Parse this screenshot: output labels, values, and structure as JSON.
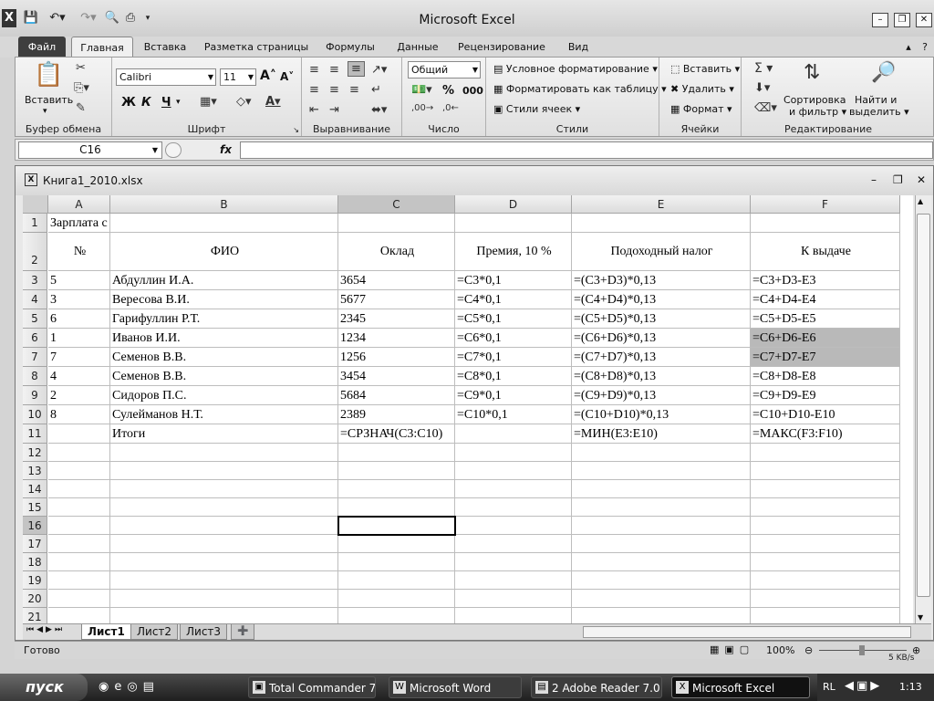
{
  "app": {
    "title": "Microsoft Excel",
    "tabs": [
      "Файл",
      "Главная",
      "Вставка",
      "Разметка страницы",
      "Формулы",
      "Данные",
      "Рецензирование",
      "Вид"
    ]
  },
  "ribbon": {
    "clipboard": {
      "paste": "Вставить",
      "label": "Буфер обмена"
    },
    "font": {
      "name": "Calibri",
      "size": "11",
      "label": "Шрифт",
      "bold": "Ж",
      "italic": "К",
      "underline": "Ч"
    },
    "alignment": {
      "label": "Выравнивание"
    },
    "number": {
      "format": "Общий",
      "label": "Число",
      "percent": "%",
      "thousands": "000"
    },
    "styles": {
      "cond": "Условное форматирование",
      "table": "Форматировать как таблицу",
      "cell": "Стили ячеек",
      "label": "Стили"
    },
    "cells": {
      "insert": "Вставить",
      "delete": "Удалить",
      "format": "Формат",
      "label": "Ячейки"
    },
    "editing": {
      "sort1": "Сортировка",
      "sort2": "и фильтр",
      "find1": "Найти и",
      "find2": "выделить",
      "label": "Редактирование"
    }
  },
  "formula_bar": {
    "name_box": "C16",
    "fx": "fx",
    "value": ""
  },
  "workbook": {
    "title": "Книга1_2010.xlsx"
  },
  "sheet": {
    "columns": [
      "A",
      "B",
      "C",
      "D",
      "E",
      "F"
    ],
    "row_numbers": [
      "1",
      "2",
      "3",
      "4",
      "5",
      "6",
      "7",
      "8",
      "9",
      "10",
      "11",
      "12",
      "13",
      "14",
      "15",
      "16",
      "17",
      "18",
      "19",
      "20",
      "21"
    ],
    "title_cell": "Зарплата с",
    "headers": [
      "№",
      "ФИО",
      "Оклад",
      "Премия, 10 %",
      "Подоходный налог",
      "К выдаче"
    ],
    "rows": [
      [
        "5",
        "Абдуллин И.А.",
        "3654",
        "=C3*0,1",
        "=(C3+D3)*0,13",
        "=C3+D3-E3"
      ],
      [
        "3",
        "Вересова В.И.",
        "5677",
        "=C4*0,1",
        "=(C4+D4)*0,13",
        "=C4+D4-E4"
      ],
      [
        "6",
        "Гарифуллин Р.Т.",
        "2345",
        "=C5*0,1",
        "=(C5+D5)*0,13",
        "=C5+D5-E5"
      ],
      [
        "1",
        "Иванов И.И.",
        "1234",
        "=C6*0,1",
        "=(C6+D6)*0,13",
        "=C6+D6-E6"
      ],
      [
        "7",
        "Семенов В.В.",
        "1256",
        "=C7*0,1",
        "=(C7+D7)*0,13",
        "=C7+D7-E7"
      ],
      [
        "4",
        "Семенов В.В.",
        "3454",
        "=C8*0,1",
        "=(C8+D8)*0,13",
        "=C8+D8-E8"
      ],
      [
        "2",
        "Сидоров П.С.",
        "5684",
        "=C9*0,1",
        "=(C9+D9)*0,13",
        "=C9+D9-E9"
      ],
      [
        "8",
        "Сулейманов Н.Т.",
        "2389",
        "=C10*0,1",
        "=(C10+D10)*0,13",
        "=C10+D10-E10"
      ]
    ],
    "totals": {
      "label": "Итоги",
      "c": "=СРЗНАЧ(C3:C10)",
      "e": "=МИН(E3:E10)",
      "f": "=МАКС(F3:F10)"
    },
    "sheet_tabs": [
      "Лист1",
      "Лист2",
      "Лист3"
    ]
  },
  "status": {
    "ready": "Готово",
    "zoom": "100%"
  },
  "taskbar": {
    "start": "пуск",
    "items": [
      "Total Commander 7....",
      "Microsoft Word",
      "2 Adobe Reader 7.0",
      "Microsoft Excel"
    ],
    "lang": "RL",
    "clock": "1:13",
    "net": "5 KB/s"
  }
}
